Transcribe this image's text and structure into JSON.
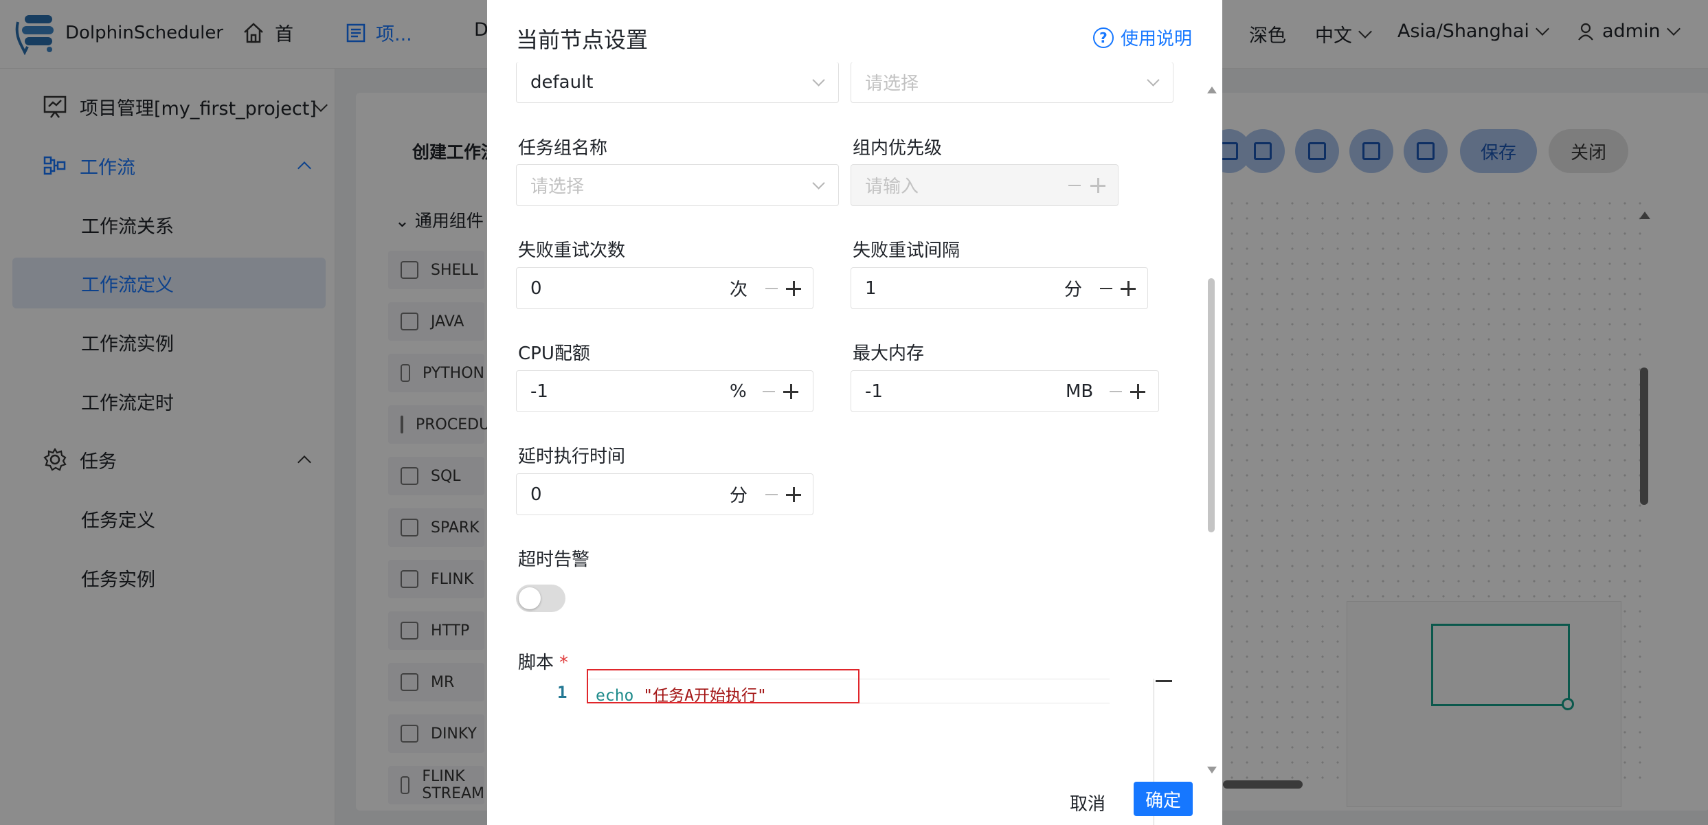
{
  "header": {
    "brand": "DolphinScheduler",
    "nav": [
      {
        "label": "首",
        "icon": "home-icon"
      },
      {
        "label": "项...",
        "icon": "project-icon"
      },
      {
        "label": "D",
        "icon": "datasource-icon"
      }
    ],
    "theme": "深色",
    "language": "中文",
    "timezone": "Asia/Shanghai",
    "user": "admin"
  },
  "sidebar": {
    "project": "项目管理[my_first_project]",
    "workflow": "工作流",
    "workflow_items": [
      "工作流关系",
      "工作流定义",
      "工作流实例",
      "工作流定时"
    ],
    "task": "任务",
    "task_items": [
      "任务定义",
      "任务实例"
    ]
  },
  "main": {
    "toolbar_title": "创建工作流",
    "component_group": "通用组件",
    "components": [
      "SHELL",
      "JAVA",
      "PYTHON",
      "PROCEDURE",
      "SQL",
      "SPARK",
      "FLINK",
      "HTTP",
      "MR",
      "DINKY",
      "FLINK STREAM"
    ],
    "save": "保存",
    "close": "关闭"
  },
  "drawer": {
    "title": "当前节点设置",
    "help": "使用说明",
    "top_select_value": "default",
    "top_select_placeholder": "请选择",
    "task_group_label": "任务组名称",
    "task_group_placeholder": "请选择",
    "group_priority_label": "组内优先级",
    "group_priority_placeholder": "请输入",
    "retry_times_label": "失败重试次数",
    "retry_times_value": "0",
    "retry_times_unit": "次",
    "retry_interval_label": "失败重试间隔",
    "retry_interval_value": "1",
    "retry_interval_unit": "分",
    "cpu_label": "CPU配额",
    "cpu_value": "-1",
    "cpu_unit": "%",
    "memory_label": "最大内存",
    "memory_value": "-1",
    "memory_unit": "MB",
    "delay_label": "延时执行时间",
    "delay_value": "0",
    "delay_unit": "分",
    "timeout_label": "超时告警",
    "timeout_enabled": false,
    "script_label": "脚本",
    "script_required": "*",
    "script_line_no": "1",
    "script_keyword": "echo",
    "script_string": "\"任务A开始执行\"",
    "cancel": "取消",
    "confirm": "确定"
  },
  "colors": {
    "primary": "#1677ff",
    "highlight": "#e0262b",
    "minimap": "#14a08a"
  }
}
